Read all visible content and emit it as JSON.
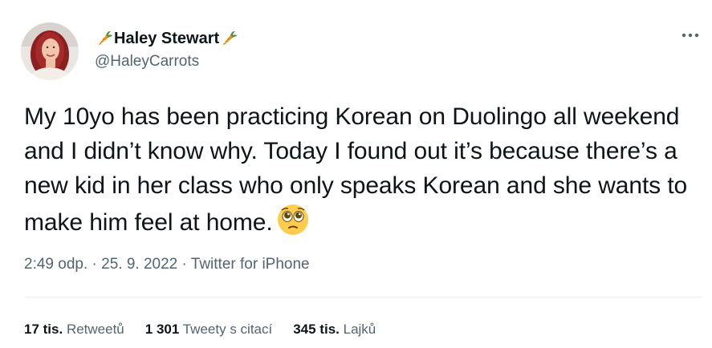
{
  "author": {
    "display_name": "Haley Stewart",
    "handle": "@HaleyCarrots",
    "name_emoji": "carrot-icon"
  },
  "tweet": {
    "text": "My 10yo has been practicing Korean on Duolingo all weekend and I didn’t know why. Today I found out it’s because there’s a new kid in her class who only speaks Korean and she wants to make him feel at home.",
    "emoji": "face-holding-back-tears-icon"
  },
  "meta": {
    "time": "2:49 odp.",
    "date": "25. 9. 2022",
    "source": "Twitter for iPhone",
    "separator": "·"
  },
  "stats": {
    "retweets_count": "17 tis.",
    "retweets_label": "Retweetů",
    "quotes_count": "1 301",
    "quotes_label": "Tweety s citací",
    "likes_count": "345 tis.",
    "likes_label": "Lajků"
  },
  "colors": {
    "text_primary": "#0f1419",
    "text_secondary": "#536471",
    "divider": "#eff3f4"
  }
}
